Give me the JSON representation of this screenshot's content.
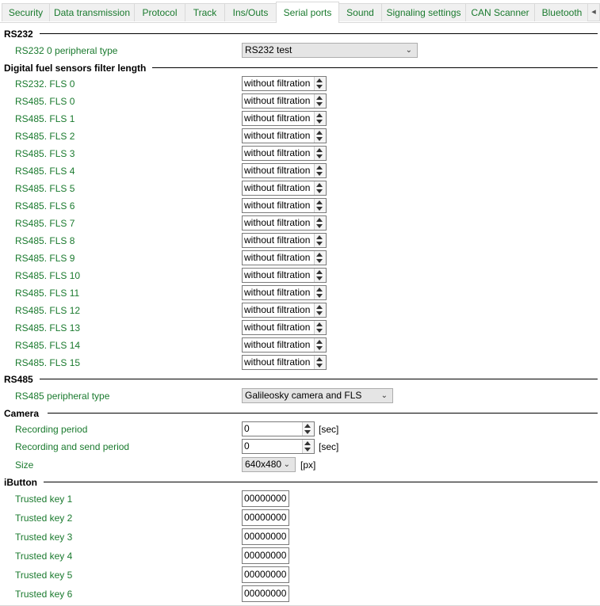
{
  "tabs": [
    "Security",
    "Data transmission",
    "Protocol",
    "Track",
    "Ins/Outs",
    "Serial ports",
    "Sound",
    "Signaling settings",
    "CAN Scanner",
    "Bluetooth"
  ],
  "active_tab": "Serial ports",
  "tab_scroll_icon": "chevron-left-icon",
  "rs232": {
    "title": "RS232",
    "peripheral_label": "RS232 0 peripheral type",
    "peripheral_value": "RS232 test"
  },
  "fls": {
    "title": "Digital fuel sensors filter length",
    "rows": [
      {
        "label": "RS232. FLS 0",
        "value": "without filtration"
      },
      {
        "label": "RS485. FLS 0",
        "value": "without filtration"
      },
      {
        "label": "RS485. FLS 1",
        "value": "without filtration"
      },
      {
        "label": "RS485. FLS 2",
        "value": "without filtration"
      },
      {
        "label": "RS485. FLS 3",
        "value": "without filtration"
      },
      {
        "label": "RS485. FLS 4",
        "value": "without filtration"
      },
      {
        "label": "RS485. FLS 5",
        "value": "without filtration"
      },
      {
        "label": "RS485. FLS 6",
        "value": "without filtration"
      },
      {
        "label": "RS485. FLS 7",
        "value": "without filtration"
      },
      {
        "label": "RS485. FLS 8",
        "value": "without filtration"
      },
      {
        "label": "RS485. FLS 9",
        "value": "without filtration"
      },
      {
        "label": "RS485. FLS 10",
        "value": "without filtration"
      },
      {
        "label": "RS485. FLS 11",
        "value": "without filtration"
      },
      {
        "label": "RS485. FLS 12",
        "value": "without filtration"
      },
      {
        "label": "RS485. FLS 13",
        "value": "without filtration"
      },
      {
        "label": "RS485. FLS 14",
        "value": "without filtration"
      },
      {
        "label": "RS485. FLS 15",
        "value": "without filtration"
      }
    ]
  },
  "rs485": {
    "title": "RS485",
    "peripheral_label": "RS485 peripheral type",
    "peripheral_value": "Galileosky camera and FLS"
  },
  "camera": {
    "title": "Camera",
    "recording_period_label": "Recording period",
    "recording_period_value": "0",
    "recording_period_unit": "[sec]",
    "record_send_label": "Recording and send period",
    "record_send_value": "0",
    "record_send_unit": "[sec]",
    "size_label": "Size",
    "size_value": "640x480",
    "size_unit": "[px]"
  },
  "ibutton": {
    "title": "iButton",
    "keys": [
      {
        "label": "Trusted key 1",
        "value": "00000000"
      },
      {
        "label": "Trusted key 2",
        "value": "00000000"
      },
      {
        "label": "Trusted key 3",
        "value": "00000000"
      },
      {
        "label": "Trusted key 4",
        "value": "00000000"
      },
      {
        "label": "Trusted key 5",
        "value": "00000000"
      },
      {
        "label": "Trusted key 6",
        "value": "00000000"
      }
    ]
  }
}
